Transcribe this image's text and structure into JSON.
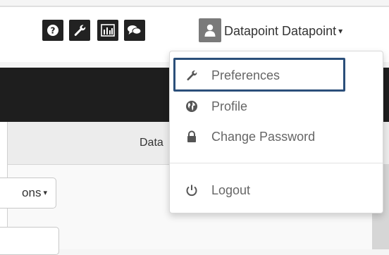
{
  "topbar": {
    "icons": [
      {
        "name": "help-icon",
        "glyph": "?"
      },
      {
        "name": "wrench-icon"
      },
      {
        "name": "bar-chart-icon"
      },
      {
        "name": "chat-icon"
      },
      {
        "name": "user-icon"
      }
    ],
    "user_name": "Datapoint Datapoint",
    "caret": "▾"
  },
  "subheader": {
    "text": "Data"
  },
  "toolbar": {
    "options_label": "ons",
    "options_caret": "▾"
  },
  "user_menu": {
    "items": [
      {
        "label": "Preferences",
        "icon": "wrench-icon"
      },
      {
        "label": "Profile",
        "icon": "globe-icon"
      },
      {
        "label": "Change Password",
        "icon": "lock-icon"
      },
      {
        "label": "Logout",
        "icon": "power-icon"
      }
    ]
  },
  "colors": {
    "highlight_border": "#2b4f7a",
    "icon_button_bg": "#222222",
    "user_button_bg": "#7a7a7a"
  }
}
